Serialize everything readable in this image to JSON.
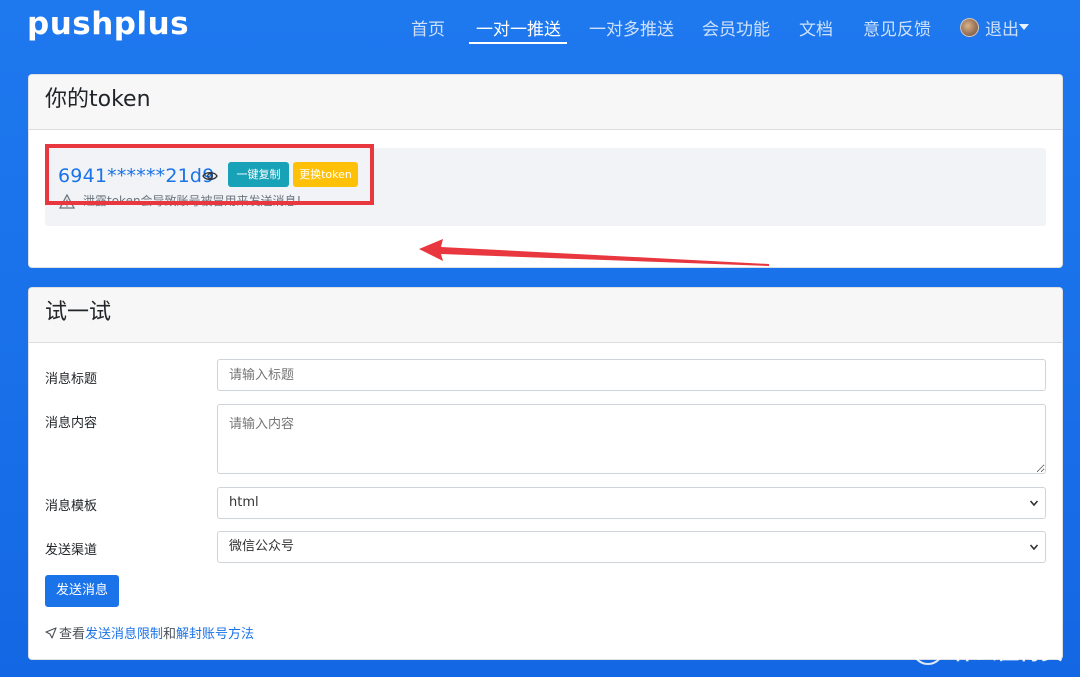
{
  "navbar": {
    "brand": "pushplus",
    "items": [
      {
        "label": "首页"
      },
      {
        "label": "一对一推送"
      },
      {
        "label": "一对多推送"
      },
      {
        "label": "会员功能"
      },
      {
        "label": "文档"
      },
      {
        "label": "意见反馈"
      }
    ],
    "user_menu_label": "退出"
  },
  "token_card": {
    "title": "你的token",
    "token_value": "6941******21d9",
    "copy_button": "一键复制",
    "change_button": "更换token",
    "warning": "泄露token会导致账号被冒用来发送消息!"
  },
  "try_card": {
    "title": "试一试",
    "title_label": "消息标题",
    "title_placeholder": "请输入标题",
    "content_label": "消息内容",
    "content_placeholder": "请输入内容",
    "template_label": "消息模板",
    "template_value": "html",
    "channel_label": "发送渠道",
    "channel_value": "微信公众号",
    "send_button": "发送消息",
    "footer_prefix": "查看",
    "footer_link1": "发送消息限制",
    "footer_middle": "和",
    "footer_link2": "解封账号方法"
  },
  "watermark": {
    "logo_char": "值",
    "text": "什么值得买"
  },
  "colors": {
    "primary": "#1a73e8",
    "info": "#17a2b8",
    "warning": "#ffc107",
    "annotation_red": "#e8373e",
    "background_blue": "#1a72ea"
  }
}
